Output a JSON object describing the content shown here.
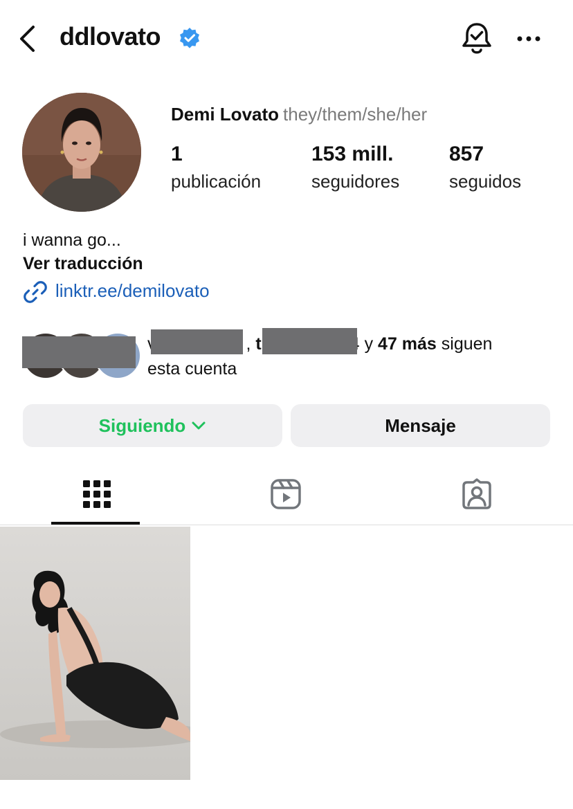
{
  "header": {
    "username": "ddlovato",
    "icons": [
      "back-chevron-icon",
      "verified-badge-icon",
      "notification-bell-icon",
      "more-options-icon"
    ]
  },
  "profile": {
    "name": "Demi Lovato",
    "pronouns": "they/them/she/her",
    "stats": [
      {
        "value": "1",
        "label": "publicación"
      },
      {
        "value": "153 mill.",
        "label": "seguidores"
      },
      {
        "value": "857",
        "label": "seguidos"
      }
    ],
    "bio": "i wanna go...",
    "translate": "Ver traducción",
    "link": "linktr.ee/demilovato"
  },
  "mutuals": {
    "name1_start": "v",
    "name1_end": ",",
    "name2_start": "t",
    "name2_end": "4",
    "connector": " y ",
    "more": "47 más",
    "follow_text": " siguen",
    "line2": "esta cuenta"
  },
  "buttons": {
    "following": "Siguiendo",
    "message": "Mensaje"
  },
  "tabs": [
    "grid-icon",
    "reels-icon",
    "tagged-icon"
  ],
  "colors": {
    "accent_green": "#1fc15c",
    "link_blue": "#1b5fb8",
    "verified_blue": "#3897f0",
    "redaction_gray": "#6e6e70"
  }
}
